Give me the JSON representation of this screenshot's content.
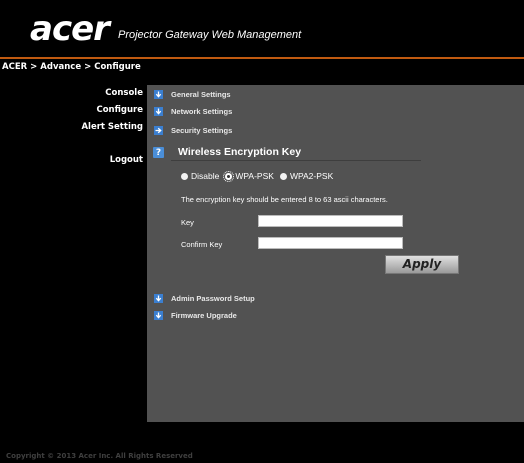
{
  "header": {
    "logo_text": "acer",
    "app_title": "Projector Gateway Web Management"
  },
  "breadcrumb": [
    "ACER",
    "Advance",
    "Configure"
  ],
  "breadcrumb_sep": ">",
  "nav": {
    "console": "Console",
    "configure": "Configure",
    "alert_setting": "Alert Setting",
    "logout": "Logout"
  },
  "sections": {
    "general": "General Settings",
    "network": "Network Settings",
    "security": "Security Settings",
    "admin_password": "Admin Password Setup",
    "firmware": "Firmware Upgrade"
  },
  "wireless": {
    "icon_glyph": "?",
    "title": "Wireless Encryption Key",
    "options": {
      "disable": "Disable",
      "wpa_psk": "WPA-PSK",
      "wpa2_psk": "WPA2-PSK"
    },
    "selected": "WPA-PSK",
    "hint": "The encryption key should be entered 8 to 63 ascii characters.",
    "key_label": "Key",
    "key_value": "",
    "confirm_label": "Confirm Key",
    "confirm_value": "",
    "apply_label": "Apply"
  },
  "footer": {
    "copyright": "Copyright © 2013 Acer Inc. All Rights Reserved"
  },
  "colors": {
    "accent_orange": "#c05a10",
    "panel_gray": "#525252",
    "icon_blue": "#3b7fd0"
  }
}
